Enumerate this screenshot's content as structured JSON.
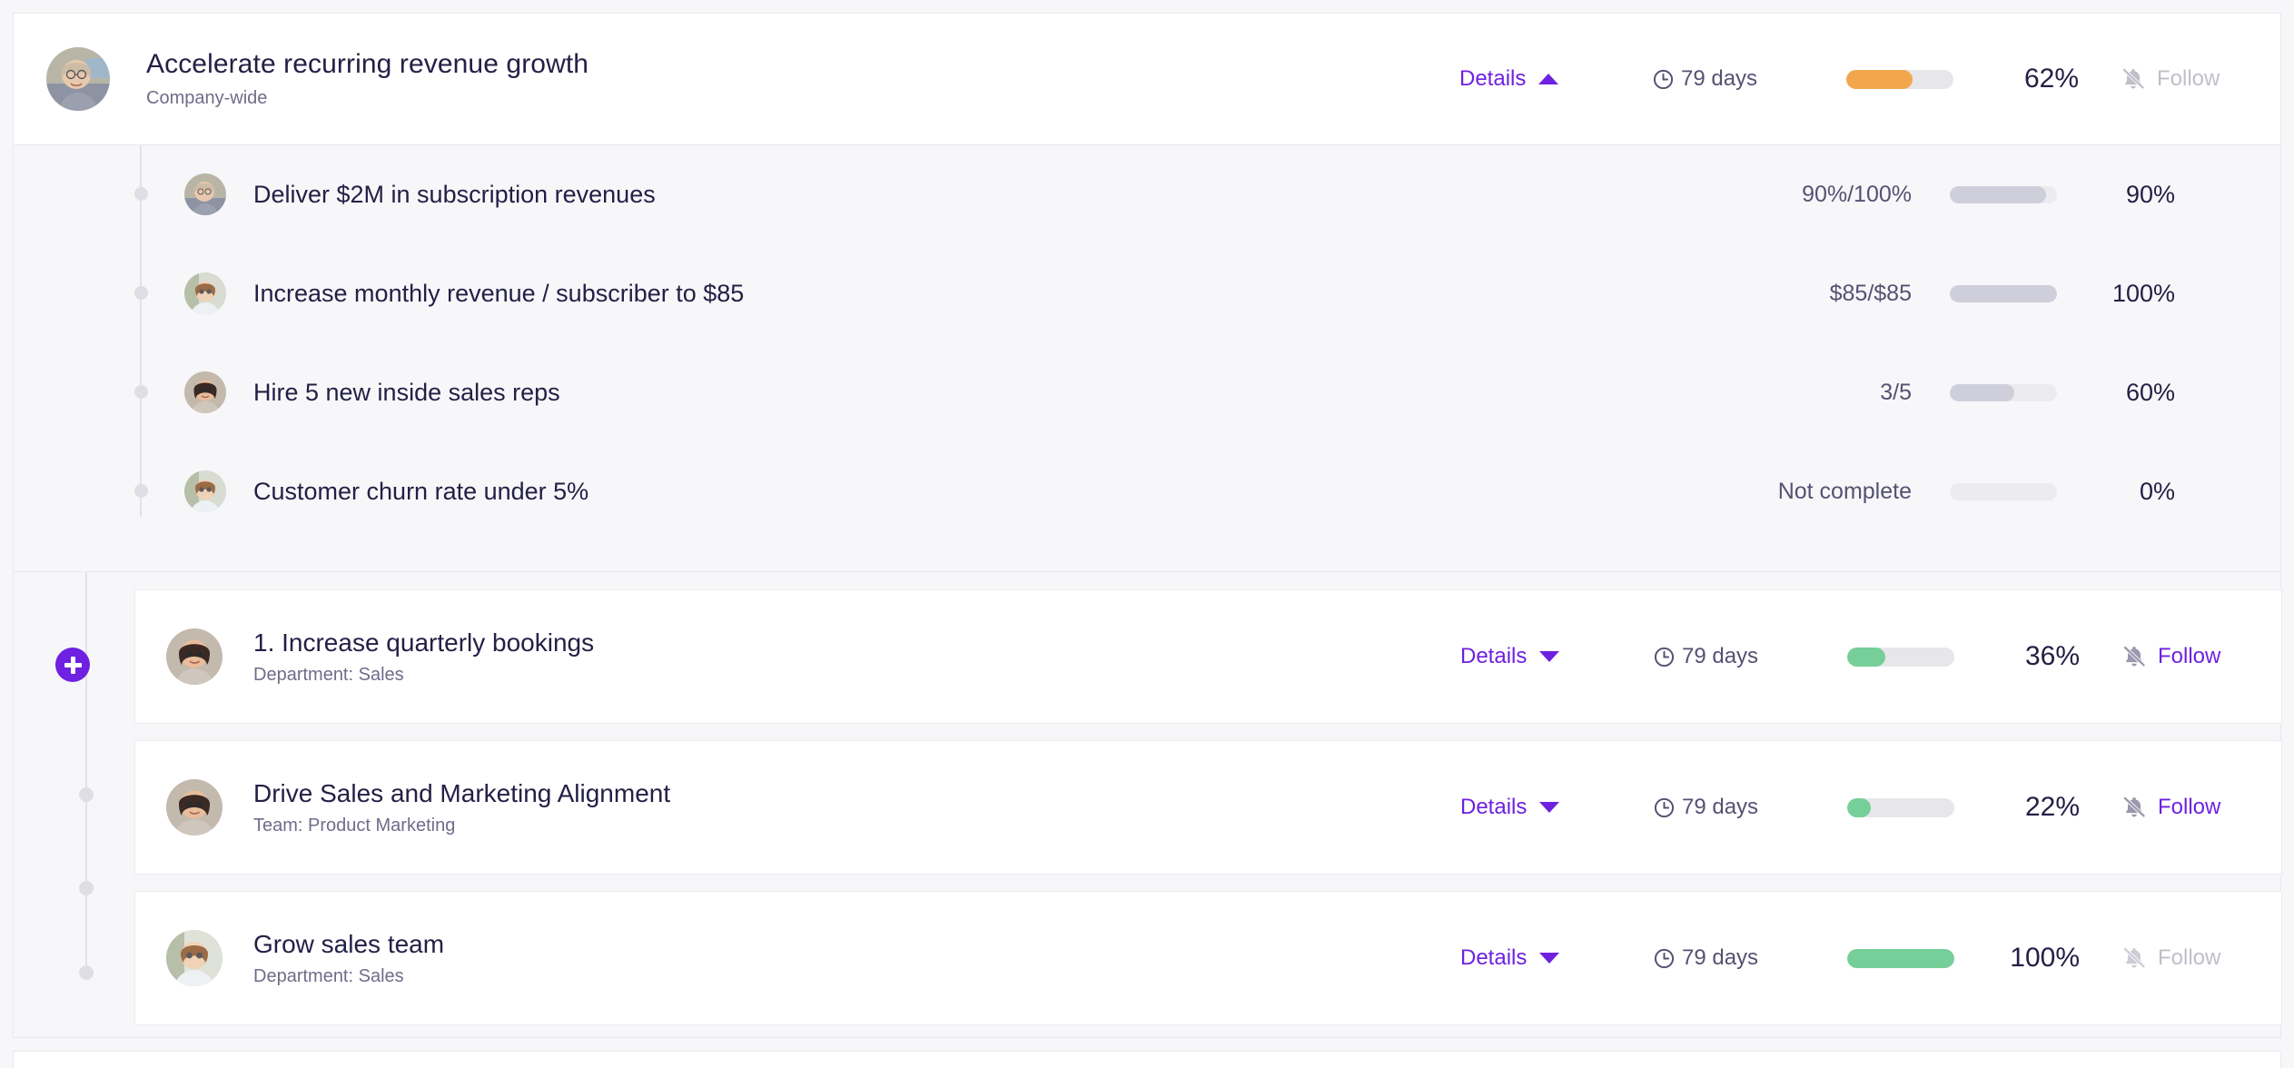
{
  "colors": {
    "accent_purple": "#6e21e0",
    "title_navy": "#232046",
    "muted": "#6f6c89",
    "progress_orange": "#f2a74c",
    "progress_green": "#76cf98",
    "progress_grey": "#cfcedb",
    "track": "#e7e7ea",
    "page_bg": "#f7f7f9",
    "card_bg": "#ffffff",
    "border": "#e9e9ee"
  },
  "objective": {
    "title": "Accelerate recurring revenue growth",
    "subtitle": "Company-wide",
    "details_label": "Details",
    "details_caret": "caret-up",
    "days_label": "79 days",
    "progress_percent": 62,
    "progress_label": "62%",
    "progress_color": "#f2a74c",
    "follow_label": "Follow",
    "follow_active": false,
    "avatar": "avatar-man-glasses"
  },
  "key_results": {
    "rows": [
      {
        "title": "Deliver $2M in subscription revenues",
        "value": "90%/100%",
        "progress_percent": 90,
        "progress_label": "90%",
        "avatar": "avatar-man-glasses"
      },
      {
        "title": "Increase monthly revenue / subscriber to $85",
        "value": "$85/$85",
        "progress_percent": 100,
        "progress_label": "100%",
        "avatar": "avatar-woman-curly"
      },
      {
        "title": "Hire 5 new inside sales reps",
        "value": "3/5",
        "progress_percent": 60,
        "progress_label": "60%",
        "avatar": "avatar-woman-dark-hair"
      },
      {
        "title": "Customer churn rate under 5%",
        "value": "Not complete",
        "progress_percent": 0,
        "progress_label": "0%",
        "avatar": "avatar-woman-curly"
      }
    ]
  },
  "children": {
    "add_button_label": "add-child-objective",
    "cards": [
      {
        "title": "1. Increase quarterly bookings",
        "subtitle": "Department: Sales",
        "details_label": "Details",
        "details_caret": "caret-down",
        "days_label": "79 days",
        "progress_percent": 36,
        "progress_label": "36%",
        "progress_color": "#76cf98",
        "follow_label": "Follow",
        "follow_active": true,
        "avatar": "avatar-woman-dark-hair"
      },
      {
        "title": "Drive Sales and Marketing Alignment",
        "subtitle": "Team: Product Marketing",
        "details_label": "Details",
        "details_caret": "caret-down",
        "days_label": "79 days",
        "progress_percent": 22,
        "progress_label": "22%",
        "progress_color": "#76cf98",
        "follow_label": "Follow",
        "follow_active": true,
        "avatar": "avatar-woman-dark-hair"
      },
      {
        "title": "Grow sales team",
        "subtitle": "Department: Sales",
        "details_label": "Details",
        "details_caret": "caret-down",
        "days_label": "79 days",
        "progress_percent": 100,
        "progress_label": "100%",
        "progress_color": "#76cf98",
        "follow_label": "Follow",
        "follow_active": false,
        "avatar": "avatar-woman-curly"
      }
    ]
  },
  "icons": {
    "clock": "clock-icon",
    "bell_slash": "bell-slash-icon",
    "plus": "plus-icon"
  }
}
